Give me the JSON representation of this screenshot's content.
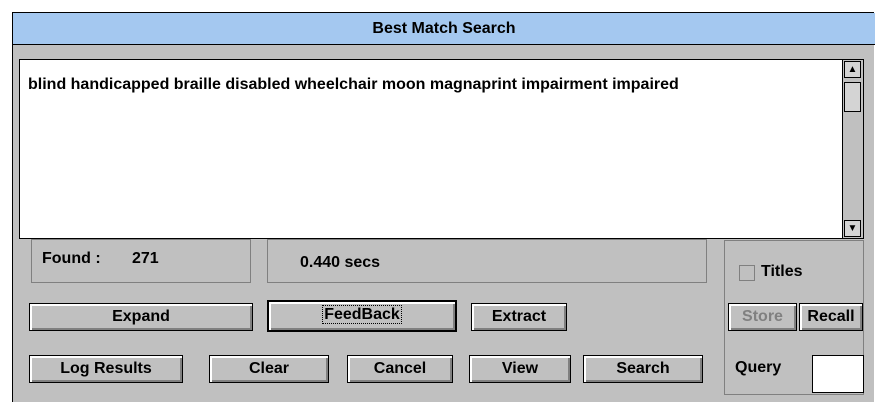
{
  "window": {
    "title": "Best Match Search"
  },
  "query": {
    "text": "blind handicapped braille disabled wheelchair moon magnaprint impairment impaired"
  },
  "scroll": {
    "up": "▲",
    "down": "▼"
  },
  "status": {
    "found_label": "Found :",
    "found_count": "271",
    "time": "0.440 secs"
  },
  "options": {
    "titles_label": "Titles"
  },
  "buttons": {
    "expand": "Expand",
    "feedback": "FeedBack",
    "extract": "Extract",
    "store": "Store",
    "recall": "Recall",
    "log_results": "Log Results",
    "clear": "Clear",
    "cancel": "Cancel",
    "view": "View",
    "search": "Search"
  },
  "query_field": {
    "label": "Query",
    "value": ""
  }
}
